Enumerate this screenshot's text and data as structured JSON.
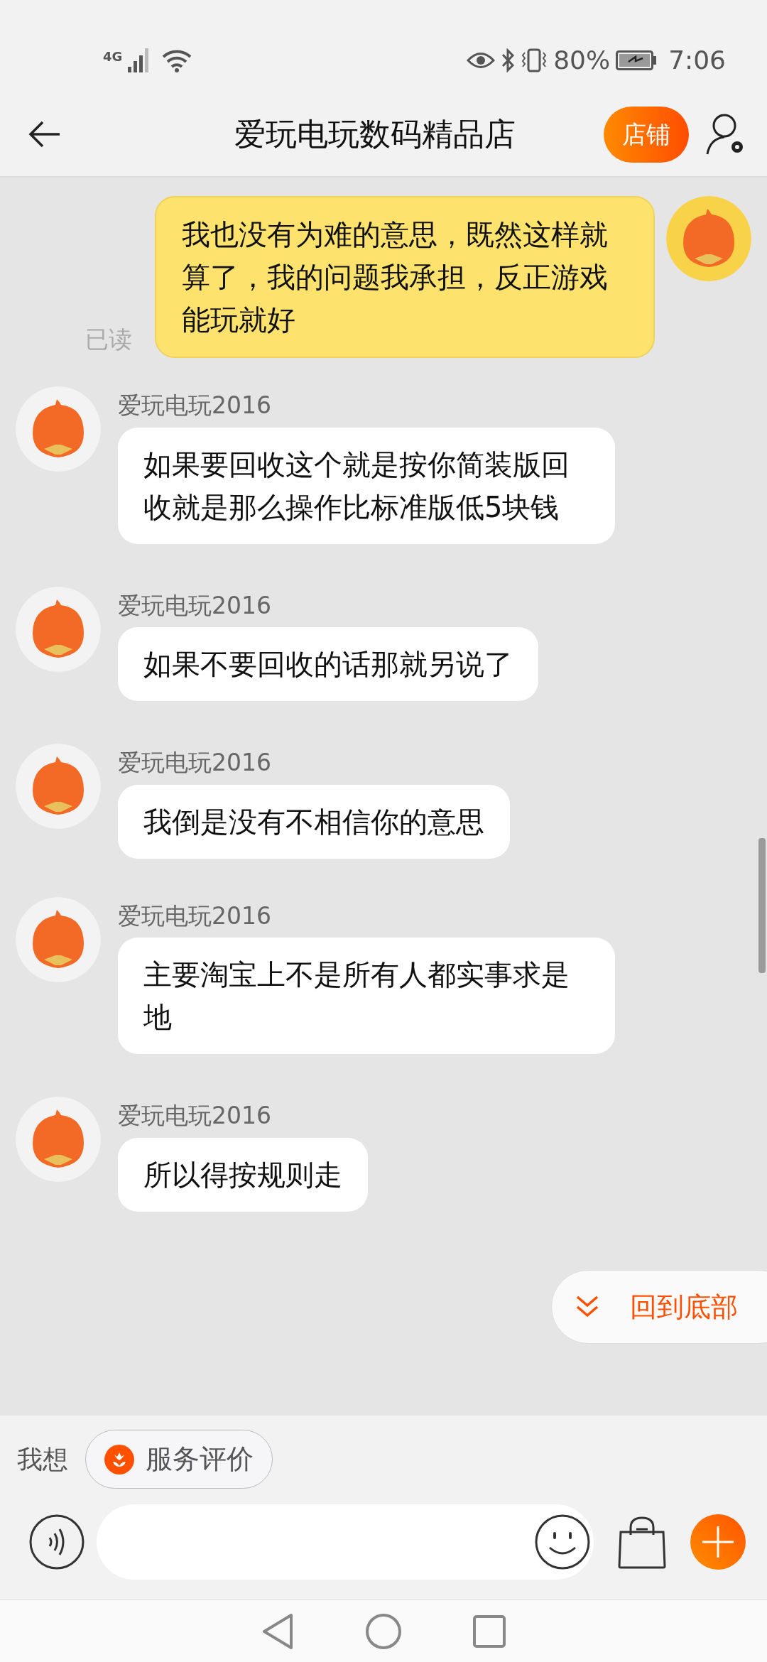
{
  "status_bar": {
    "network": "4G",
    "battery": "80%",
    "time": "7:06"
  },
  "header": {
    "title": "爱玩电玩数码精品店",
    "shop_button": "店铺"
  },
  "messages": [
    {
      "kind": "outgoing",
      "text": "我也没有为难的意思，既然这样就算了，我的问题我承担，反正游戏能玩就好",
      "read_label": "已读"
    },
    {
      "kind": "incoming",
      "sender": "爱玩电玩2016",
      "text": "如果要回收这个就是按你简装版回收就是那么操作比标准版低5块钱"
    },
    {
      "kind": "incoming",
      "sender": "爱玩电玩2016",
      "text": "如果不要回收的话那就另说了"
    },
    {
      "kind": "incoming",
      "sender": "爱玩电玩2016",
      "text": "我倒是没有不相信你的意思"
    },
    {
      "kind": "incoming",
      "sender": "爱玩电玩2016",
      "text": "主要淘宝上不是所有人都实事求是地"
    },
    {
      "kind": "incoming",
      "sender": "爱玩电玩2016",
      "text": "所以得按规则走"
    }
  ],
  "jump_button": "回到底部",
  "quick_bar": {
    "label": "我想",
    "chips": [
      "服务评价"
    ]
  }
}
